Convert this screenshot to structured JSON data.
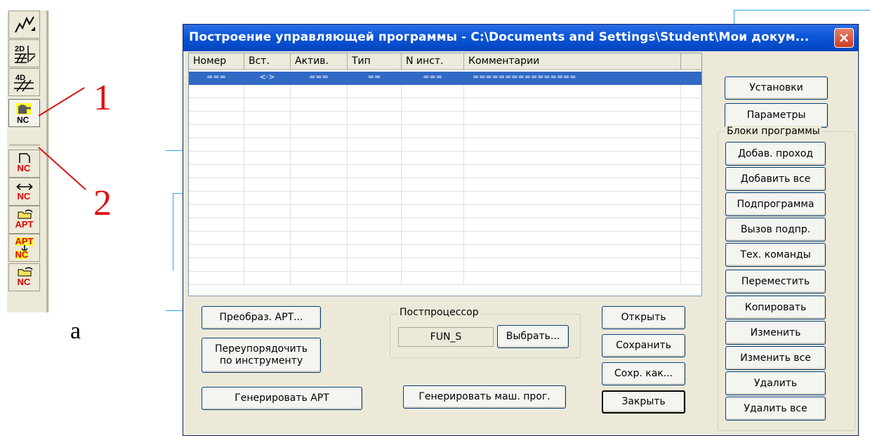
{
  "toolbar": {
    "buttons": [
      {
        "icon": "plane-wave-icon"
      },
      {
        "icon": "hatch-2d-icon",
        "label": "2D"
      },
      {
        "icon": "hatch-4d-icon",
        "label": "4D"
      },
      {
        "icon": "nc-program-icon",
        "label": "NC"
      },
      {
        "icon": "new-nc-icon",
        "label": "NC"
      },
      {
        "icon": "transfer-nc-icon",
        "label": "NC"
      },
      {
        "icon": "open-apt-icon",
        "label": "APT"
      },
      {
        "icon": "apt-to-nc-icon",
        "label_top": "APT",
        "label_bottom": "NC"
      },
      {
        "icon": "open-nc-icon",
        "label": "NC"
      }
    ],
    "callout_1": "1",
    "callout_2": "2",
    "caption": "а"
  },
  "dialog": {
    "title": "Построение управляющей программы - C:\\Documents and Settings\\Student\\Мои докум...",
    "list": {
      "columns": [
        "Номер",
        "Вст.",
        "Актив.",
        "Тип",
        "N инст.",
        "Комментарии",
        ""
      ],
      "rows": [
        [
          "===",
          "<·>",
          "===",
          "==",
          "===",
          "================",
          ""
        ]
      ]
    },
    "buttons": {
      "setup": "Установки",
      "params": "Параметры",
      "convert_apt": "Преобраз. АРТ...",
      "reorder_line1": "Переупорядочить",
      "reorder_line2": "по инструменту",
      "generate_apt": "Генерировать АРТ",
      "generate_machine": "Генерировать маш. прог.",
      "select": "Выбрать...",
      "open": "Открыть",
      "save": "Сохранить",
      "save_as": "Сохр. как...",
      "close": "Закрыть"
    },
    "postprocessor": {
      "label": "Постпроцессор",
      "value": "FUN_S"
    },
    "program_blocks": {
      "label": "Блоки программы",
      "buttons": [
        "Добав. проход",
        "Добавить все",
        "Подпрограмма",
        "Вызов подпр.",
        "Тех. команды",
        "Переместить",
        "Копировать",
        "Изменить",
        "Изменить все",
        "Удалить",
        "Удалить все"
      ]
    }
  },
  "colors": {
    "title_bar": "#0a56d8",
    "selection": "#316ac5",
    "dialog_bg": "#ece9d8",
    "callout": "#e01010"
  }
}
